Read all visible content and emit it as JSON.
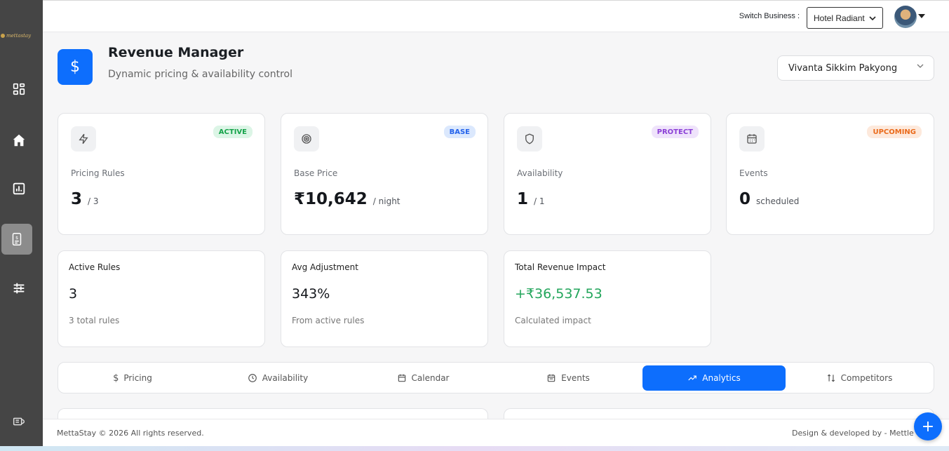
{
  "sidebar": {
    "logo_text": "mettastay",
    "items": [
      {
        "name": "dashboard-grid-icon"
      },
      {
        "name": "home-icon"
      },
      {
        "name": "bar-chart-icon"
      },
      {
        "name": "revenue-document-icon",
        "active": true
      },
      {
        "name": "sliders-icon"
      }
    ],
    "bottom_icon": "collapse-icon"
  },
  "header": {
    "switch_label": "Switch Business :",
    "business_selected": "Hotel Radiant"
  },
  "page": {
    "title": "Revenue Manager",
    "subtitle": "Dynamic pricing & availability control",
    "property_selected": "Vivanta Sikkim Pakyong"
  },
  "cards": [
    {
      "label": "Pricing Rules",
      "value": "3",
      "unit": "/ 3",
      "badge": "ACTIVE",
      "badge_color": "#16a34a",
      "badge_bg": "#dcf5e6",
      "icon": "lightning-icon"
    },
    {
      "label": "Base Price",
      "value": "₹10,642",
      "unit": "/ night",
      "badge": "BASE",
      "badge_color": "#2563eb",
      "badge_bg": "#dbe8fd",
      "icon": "target-icon"
    },
    {
      "label": "Availability",
      "value": "1",
      "unit": "/ 1",
      "badge": "PROTECT",
      "badge_color": "#8b3fd6",
      "badge_bg": "#efe3fb",
      "icon": "shield-icon"
    },
    {
      "label": "Events",
      "value": "0",
      "unit": "scheduled",
      "badge": "UPCOMING",
      "badge_color": "#ea6a1a",
      "badge_bg": "#fde9dc",
      "icon": "calendar-icon"
    }
  ],
  "stats": [
    {
      "label": "Active Rules",
      "value": "3",
      "sub": "3 total rules"
    },
    {
      "label": "Avg Adjustment",
      "value": "343%",
      "sub": "From active rules"
    },
    {
      "label": "Total Revenue Impact",
      "value": "+₹36,537.53",
      "sub": "Calculated impact",
      "value_color": "#22a55b"
    }
  ],
  "tabs": [
    {
      "label": "Pricing",
      "icon": "dollar-icon"
    },
    {
      "label": "Availability",
      "icon": "clock-icon"
    },
    {
      "label": "Calendar",
      "icon": "calendar-icon"
    },
    {
      "label": "Events",
      "icon": "calendar-icon"
    },
    {
      "label": "Analytics",
      "icon": "trend-icon",
      "active": true
    },
    {
      "label": "Competitors",
      "icon": "compare-icon"
    }
  ],
  "footer": {
    "copyright": "MettaStay © 2026 All rights reserved.",
    "credit": "Design & developed by - Mettle T"
  },
  "colors": {
    "accent": "#0d6efd"
  }
}
